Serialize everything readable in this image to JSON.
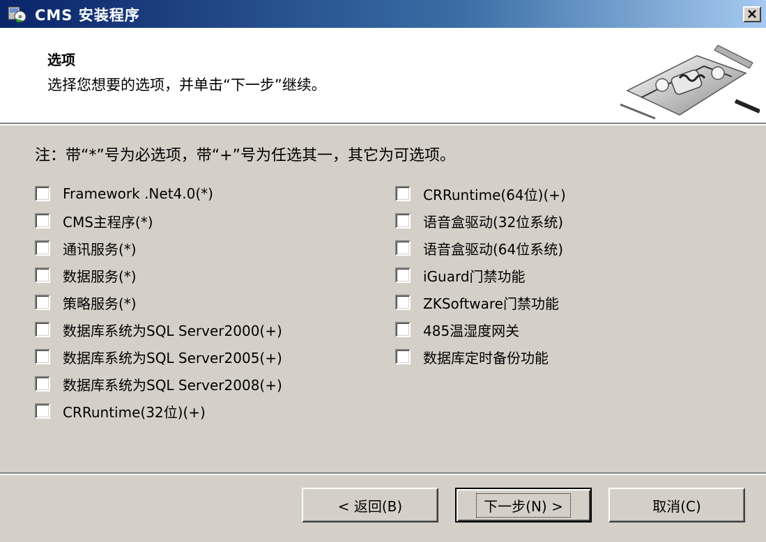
{
  "window": {
    "title": "CMS 安装程序",
    "close_glyph": "✕"
  },
  "header": {
    "title": "选项",
    "subtitle": "选择您想要的选项，并单击“下一步”继续。"
  },
  "note": "注：带“*”号为必选项，带“+”号为任选其一，其它为可选项。",
  "options_left": [
    {
      "label": "Framework .Net4.0(*)",
      "checked": false
    },
    {
      "label": "CMS主程序(*)",
      "checked": false
    },
    {
      "label": "通讯服务(*)",
      "checked": false
    },
    {
      "label": "数据服务(*)",
      "checked": false
    },
    {
      "label": "策略服务(*)",
      "checked": false
    },
    {
      "label": "数据库系统为SQL Server2000(+)",
      "checked": false
    },
    {
      "label": "数据库系统为SQL Server2005(+)",
      "checked": false
    },
    {
      "label": "数据库系统为SQL Server2008(+)",
      "checked": false
    },
    {
      "label": "CRRuntime(32位)(+)",
      "checked": false
    }
  ],
  "options_right": [
    {
      "label": "CRRuntime(64位)(+)",
      "checked": false
    },
    {
      "label": "语音盒驱动(32位系统)",
      "checked": false
    },
    {
      "label": "语音盒驱动(64位系统)",
      "checked": false
    },
    {
      "label": "iGuard门禁功能",
      "checked": false
    },
    {
      "label": "ZKSoftware门禁功能",
      "checked": false
    },
    {
      "label": "485温湿度网关",
      "checked": false
    },
    {
      "label": "数据库定时备份功能",
      "checked": false
    }
  ],
  "buttons": {
    "back": "< 返回(B)",
    "next": "下一步(N) >",
    "cancel": "取消(C)"
  },
  "colors": {
    "dialog_bg": "#d4d0c8",
    "titlebar_start": "#0a246a",
    "titlebar_end": "#a6caf0",
    "title_text": "#ffffff"
  },
  "icons": {
    "title": "installer-icon",
    "header": "gears-graphic"
  }
}
